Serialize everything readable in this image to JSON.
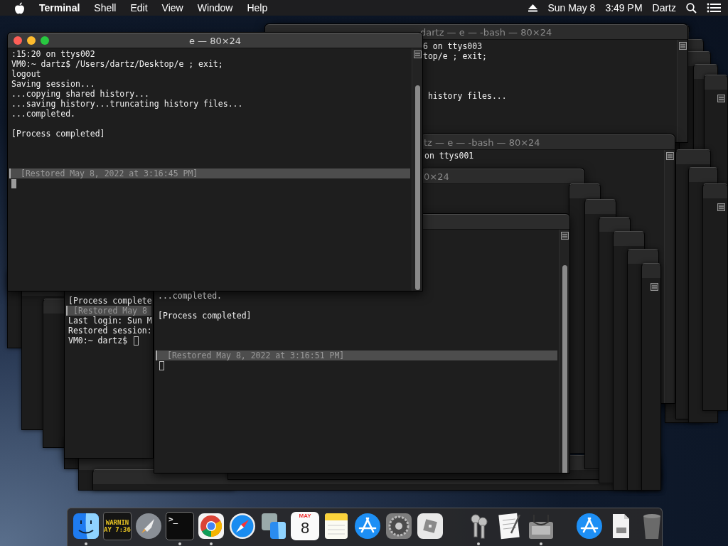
{
  "menubar": {
    "app": "Terminal",
    "menus": [
      "Shell",
      "Edit",
      "View",
      "Window",
      "Help"
    ],
    "date": "Sun May 8",
    "time": "3:49 PM",
    "user": "Dartz"
  },
  "windows": [
    {
      "title": "dartz — e — -bash — 80×24",
      "active": false,
      "lines": [
        {
          "kind": "output",
          "text": "6 on ttys003"
        },
        {
          "kind": "output",
          "text": "top/e ; exit;"
        },
        {
          "kind": "output",
          "text": "history files..."
        }
      ]
    },
    {
      "title": "tz — e — -bash — 80×24",
      "active": false,
      "lines": [
        {
          "kind": "output",
          "text": "on ttys001"
        }
      ]
    },
    {
      "title": "0×24",
      "active": false
    },
    {
      "lines": [
        {
          "kind": "output",
          "text": "[Process complete"
        },
        {
          "kind": "restored",
          "text": "[Restored May 8"
        },
        {
          "kind": "output",
          "text": "Last login: Sun M"
        },
        {
          "kind": "output",
          "text": "Restored session:"
        },
        {
          "kind": "prompt",
          "text": "VM0:~ dartz$"
        }
      ]
    },
    {
      "active": false,
      "lines": [
        {
          "kind": "output",
          "text": "...completed."
        },
        {
          "kind": "output",
          "text": "[Process completed]"
        },
        {
          "kind": "restored",
          "text": "[Restored May 8, 2022 at 3:16:51 PM]"
        },
        {
          "kind": "cursor"
        }
      ]
    },
    {
      "title": "e — 80×24",
      "active": true,
      "lines": [
        {
          "kind": "output",
          "text": ":15:20 on ttys002"
        },
        {
          "kind": "output",
          "text": "VM0:~ dartz$ /Users/dartz/Desktop/e ; exit;"
        },
        {
          "kind": "output",
          "text": "logout"
        },
        {
          "kind": "output",
          "text": "Saving session..."
        },
        {
          "kind": "output",
          "text": "...copying shared history..."
        },
        {
          "kind": "output",
          "text": "...saving history...truncating history files..."
        },
        {
          "kind": "output",
          "text": "...completed."
        },
        {
          "kind": "output",
          "text": "[Process completed]"
        },
        {
          "kind": "restored",
          "text": "[Restored May 8, 2022 at 3:16:45 PM]"
        },
        {
          "kind": "cursor"
        }
      ]
    }
  ],
  "dock": [
    {
      "kind": "face",
      "running": true
    },
    {
      "kind": "log",
      "running": false,
      "texts": [
        "WARNIN",
        "AY 7:36"
      ]
    },
    {
      "kind": "rocket",
      "running": false
    },
    {
      "kind": "prompt",
      "running": true,
      "texts": [
        ">_"
      ]
    },
    {
      "kind": "ring",
      "running": true
    },
    {
      "kind": "compass",
      "running": false
    },
    {
      "kind": "migration",
      "running": false
    },
    {
      "kind": "calendar",
      "running": false,
      "texts": [
        "MAY",
        "8"
      ]
    },
    {
      "kind": "notepad",
      "running": false
    },
    {
      "kind": "appletter",
      "running": false
    },
    {
      "kind": "gear",
      "running": false
    },
    {
      "kind": "cube",
      "running": false
    },
    {
      "kind": "separator"
    },
    {
      "kind": "keys",
      "running": true
    },
    {
      "kind": "document",
      "running": false
    },
    {
      "kind": "disk",
      "running": true
    },
    {
      "kind": "separator"
    },
    {
      "kind": "appletter",
      "running": false
    },
    {
      "kind": "file",
      "running": false
    },
    {
      "kind": "trash",
      "running": false
    }
  ]
}
